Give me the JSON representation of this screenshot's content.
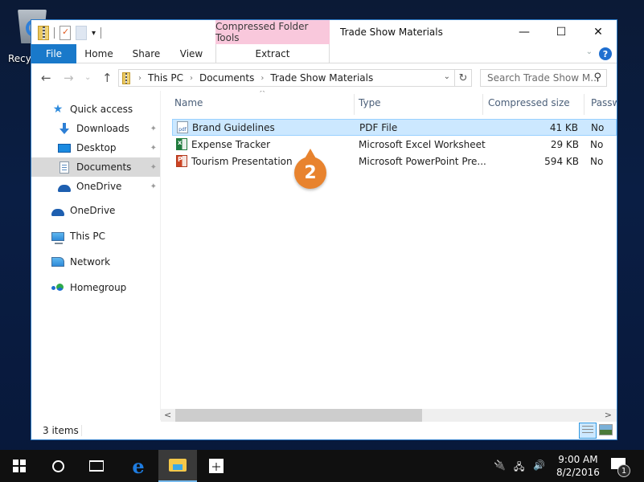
{
  "desktop": {
    "recycle_bin_label": "Recy"
  },
  "window": {
    "title": "Trade Show Materials",
    "contextual_tab_group": "Compressed Folder Tools",
    "contextual_tab_color": "#f9c8dc",
    "caption": {
      "minimize": "—",
      "maximize": "☐",
      "close": "✕"
    },
    "ribbon_tabs": [
      {
        "label": "File",
        "active": true
      },
      {
        "label": "Home"
      },
      {
        "label": "Share"
      },
      {
        "label": "View"
      },
      {
        "label": "Extract"
      }
    ],
    "help_label": "?",
    "ribbon_expand_label": "⌄"
  },
  "navigation": {
    "back": "←",
    "forward": "→",
    "recent": "⌄",
    "up": "↑",
    "breadcrumb": [
      "This PC",
      "Documents",
      "Trade Show Materials"
    ],
    "refresh": "↻",
    "search_placeholder": "Search Trade Show M...",
    "search_icon": "⚲"
  },
  "nav_pane": {
    "items": [
      {
        "label": "Quick access",
        "icon": "star-icon",
        "pinned": false
      },
      {
        "label": "Downloads",
        "icon": "download-icon",
        "pinned": true
      },
      {
        "label": "Desktop",
        "icon": "desktop-icon",
        "pinned": true
      },
      {
        "label": "Documents",
        "icon": "documents-icon",
        "pinned": true,
        "selected": true
      },
      {
        "label": "OneDrive",
        "icon": "onedrive-icon",
        "pinned": true
      },
      {
        "label": "OneDrive",
        "icon": "onedrive-icon"
      },
      {
        "label": "This PC",
        "icon": "computer-icon"
      },
      {
        "label": "Network",
        "icon": "network-icon"
      },
      {
        "label": "Homegroup",
        "icon": "homegroup-icon"
      }
    ],
    "pin_glyph": "📌"
  },
  "file_list": {
    "columns": [
      "Name",
      "Type",
      "Compressed size",
      "Passw"
    ],
    "sort_indicator": "^",
    "rows": [
      {
        "name": "Brand Guidelines",
        "type": "PDF File",
        "size": "41 KB",
        "password": "No",
        "icon": "pdf",
        "icon_text": "pdf",
        "selected": true
      },
      {
        "name": "Expense Tracker",
        "type": "Microsoft Excel Worksheet",
        "size": "29 KB",
        "password": "No",
        "icon": "xls",
        "icon_text": "x"
      },
      {
        "name": "Tourism Presentation",
        "type": "Microsoft PowerPoint Pre...",
        "size": "594 KB",
        "password": "No",
        "icon": "ppt",
        "icon_text": "P"
      }
    ]
  },
  "callout": {
    "step": "2",
    "color": "#e8832e"
  },
  "scrollbar": {
    "left": "<",
    "right": ">"
  },
  "status_bar": {
    "item_count": "3 items"
  },
  "taskbar": {
    "time": "9:00 AM",
    "date": "8/2/2016",
    "notification_count": "1",
    "edge_glyph": "e",
    "tray": {
      "power": "🔌",
      "network": "🖧",
      "volume": "🔊"
    }
  }
}
